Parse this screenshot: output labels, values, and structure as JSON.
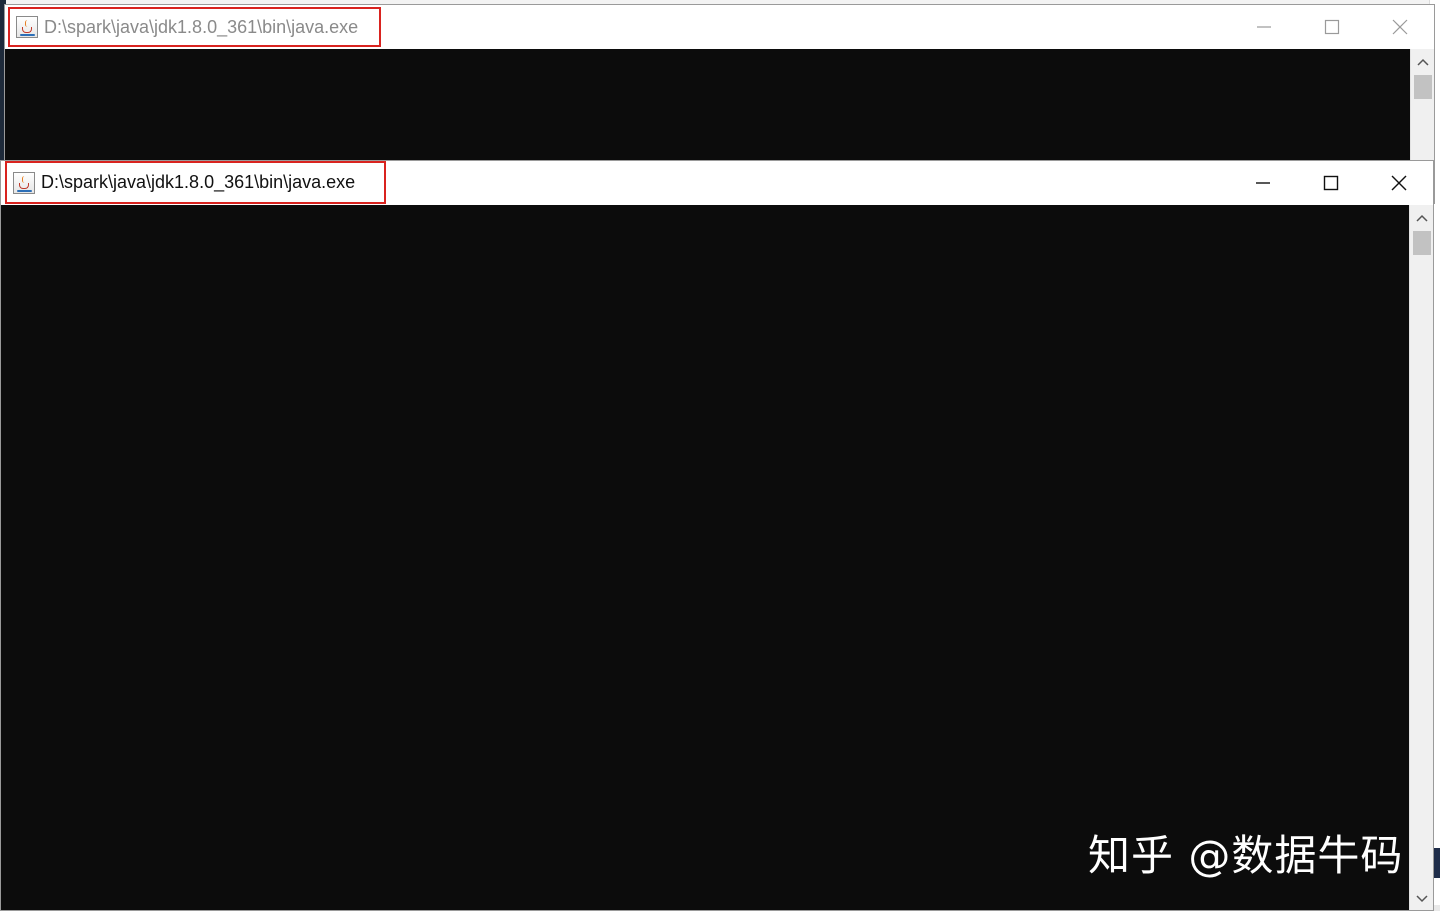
{
  "windows": {
    "back": {
      "title": "D:\\spark\\java\\jdk1.8.0_361\\bin\\java.exe",
      "icon": "java-icon",
      "active": false
    },
    "front": {
      "title": "D:\\spark\\java\\jdk1.8.0_361\\bin\\java.exe",
      "icon": "java-icon",
      "active": true
    }
  },
  "caption_buttons": [
    "minimize-icon",
    "maximize-icon",
    "close-icon"
  ],
  "highlight_color": "#d9231f",
  "console_background": "#0c0c0c",
  "watermark": {
    "text": "知乎 @数据牛码"
  }
}
